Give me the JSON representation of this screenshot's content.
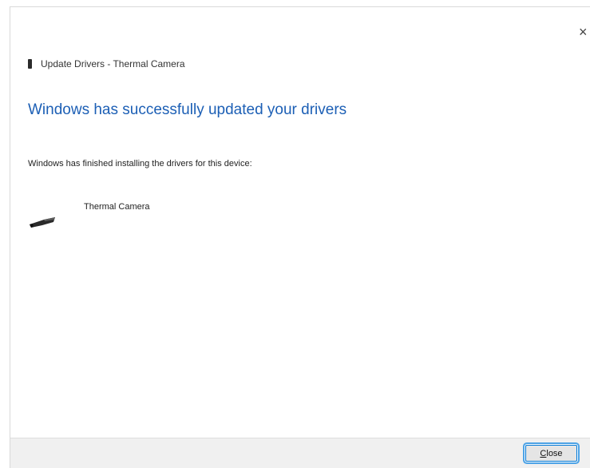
{
  "window": {
    "title": "Update Drivers - Thermal Camera",
    "close_glyph": "×"
  },
  "content": {
    "heading": "Windows has successfully updated your drivers",
    "message": "Windows has finished installing the drivers for this device:",
    "device": {
      "name": "Thermal Camera",
      "icon": "usb-device-icon"
    }
  },
  "footer": {
    "close_label_accel": "C",
    "close_label_rest": "lose"
  },
  "colors": {
    "heading": "#1c5fb5",
    "focus_ring": "#4da3e6",
    "footer_bg": "#f0f0f0"
  }
}
